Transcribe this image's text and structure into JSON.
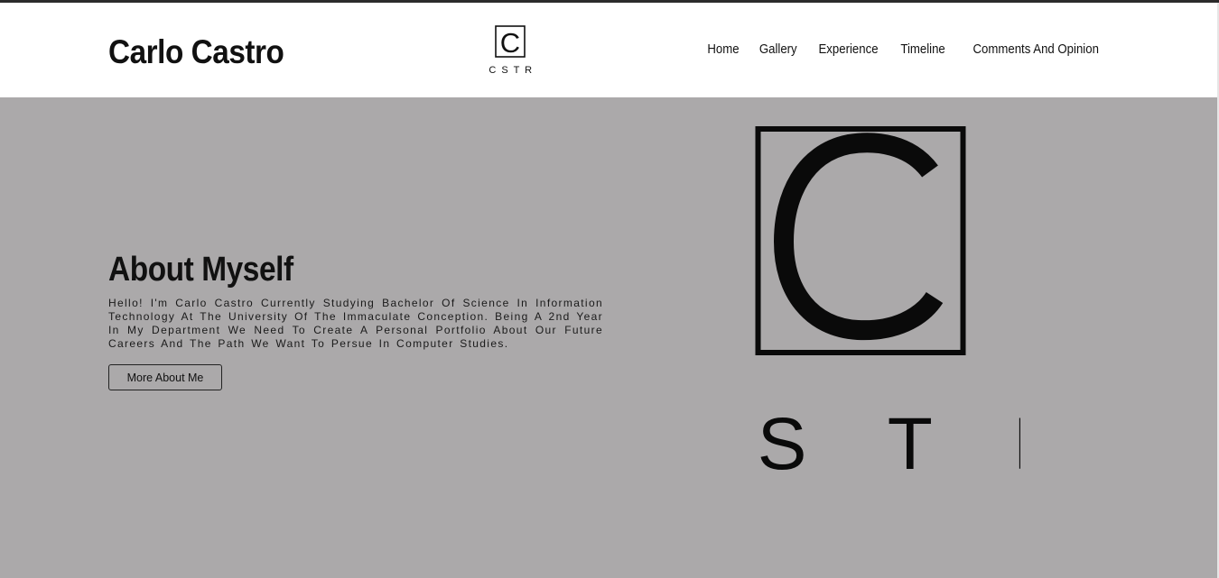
{
  "header": {
    "site_name": "Carlo Castro",
    "logo": {
      "letter": "C",
      "wordmark": "C S T R",
      "icon": "cstr-logo-icon"
    },
    "nav": [
      {
        "label": "Home"
      },
      {
        "label": "Gallery"
      },
      {
        "label": "Experience"
      },
      {
        "label": "Timeline"
      },
      {
        "label": "Comments And Opinion"
      }
    ]
  },
  "hero": {
    "title": "About Myself",
    "text": "Hello! I'm Carlo Castro Currently Studying Bachelor Of Science In Information Technology At The University Of The Immaculate Conception. Being A 2nd Year In My Department We Need To Create A Personal Portfolio About Our Future Careers And The Path We Want To Persue In Computer Studies.",
    "button_label": "More About Me",
    "logo": {
      "letter": "C",
      "wordmark": "C S T R",
      "icon": "cstr-logo-large-icon"
    }
  },
  "colors": {
    "hero_background": "#aba9aa",
    "header_background": "#ffffff",
    "text": "#111111"
  }
}
